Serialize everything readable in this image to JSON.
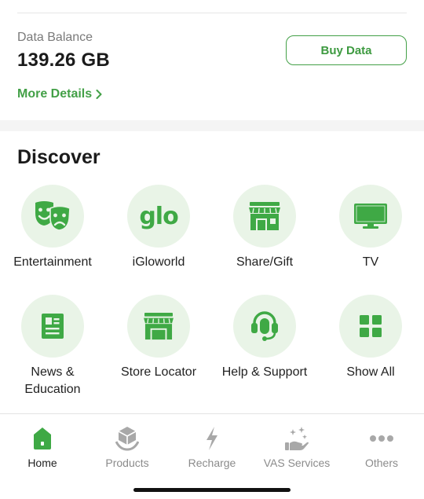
{
  "balance": {
    "label": "Data Balance",
    "value": "139.26 GB",
    "buy_label": "Buy Data",
    "more_label": "More Details"
  },
  "discover": {
    "title": "Discover",
    "tiles": [
      {
        "label": "Entertainment",
        "icon": "theater-masks-icon"
      },
      {
        "label": "iGloworld",
        "icon": "glo-logo"
      },
      {
        "label": "Share/Gift",
        "icon": "storefront-icon"
      },
      {
        "label": "TV",
        "icon": "tv-icon"
      },
      {
        "label": "News &\nEducation",
        "icon": "news-icon"
      },
      {
        "label": "Store Locator",
        "icon": "store-icon"
      },
      {
        "label": "Help & Support",
        "icon": "headset-icon"
      },
      {
        "label": "Show All",
        "icon": "grid-icon"
      }
    ],
    "logo_text": "glo"
  },
  "nav": {
    "items": [
      {
        "label": "Home",
        "icon": "home-icon",
        "active": true
      },
      {
        "label": "Products",
        "icon": "products-icon",
        "active": false
      },
      {
        "label": "Recharge",
        "icon": "lightning-icon",
        "active": false
      },
      {
        "label": "VAS Services",
        "icon": "vas-services-icon",
        "active": false
      },
      {
        "label": "Others",
        "icon": "more-dots-icon",
        "active": false
      }
    ]
  },
  "colors": {
    "accent": "#43a047",
    "icon_green": "#3fa945",
    "tile_bg": "#e9f4e7",
    "inactive_nav": "#9a9a9a"
  }
}
